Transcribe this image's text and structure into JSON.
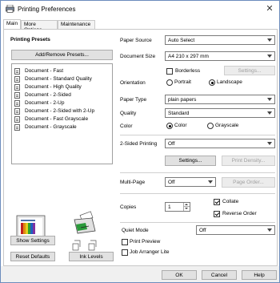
{
  "window": {
    "title": "Printing Preferences",
    "close_glyph": "✕"
  },
  "tabs": [
    {
      "label": "Main"
    },
    {
      "label": "More Options"
    },
    {
      "label": "Maintenance"
    }
  ],
  "left": {
    "presets_heading": "Printing Presets",
    "add_remove_label": "Add/Remove Presets...",
    "presets": [
      "Document - Fast",
      "Document - Standard Quality",
      "Document - High Quality",
      "Document - 2-Sided",
      "Document - 2-Up",
      "Document - 2-Sided with 2-Up",
      "Document - Fast Grayscale",
      "Document - Grayscale"
    ],
    "show_settings_label": "Show Settings",
    "reset_defaults_label": "Reset Defaults",
    "ink_levels_label": "Ink Levels"
  },
  "right": {
    "paper_source": {
      "label": "Paper Source",
      "value": "Auto Select"
    },
    "document_size": {
      "label": "Document Size",
      "value": "A4 210 x 297 mm"
    },
    "borderless": {
      "label": "Borderless",
      "checked": false
    },
    "borderless_settings_label": "Settings...",
    "orientation": {
      "label": "Orientation",
      "portrait": "Portrait",
      "landscape": "Landscape",
      "selected": "Landscape"
    },
    "paper_type": {
      "label": "Paper Type",
      "value": "plain papers"
    },
    "quality": {
      "label": "Quality",
      "value": "Standard"
    },
    "color": {
      "label": "Color",
      "color_option": "Color",
      "grayscale_option": "Grayscale",
      "selected": "Color"
    },
    "two_sided": {
      "label": "2-Sided Printing",
      "value": "Off"
    },
    "two_sided_settings_label": "Settings...",
    "print_density_label": "Print Density...",
    "multi_page": {
      "label": "Multi-Page",
      "value": "Off"
    },
    "page_order_label": "Page Order...",
    "copies": {
      "label": "Copies",
      "value": "1"
    },
    "collate": {
      "label": "Collate",
      "checked": true
    },
    "reverse_order": {
      "label": "Reverse Order",
      "checked": true
    },
    "quiet_mode": {
      "label": "Quiet Mode",
      "value": "Off"
    },
    "print_preview": {
      "label": "Print Preview",
      "checked": false
    },
    "job_arranger": {
      "label": "Job Arranger Lite",
      "checked": false
    }
  },
  "footer": {
    "ok_label": "OK",
    "cancel_label": "Cancel",
    "help_label": "Help"
  },
  "colors": {
    "accent_border": "#6c8cbc",
    "button_bg": "#e1e1e1",
    "disabled_text": "#a0a0a0"
  }
}
